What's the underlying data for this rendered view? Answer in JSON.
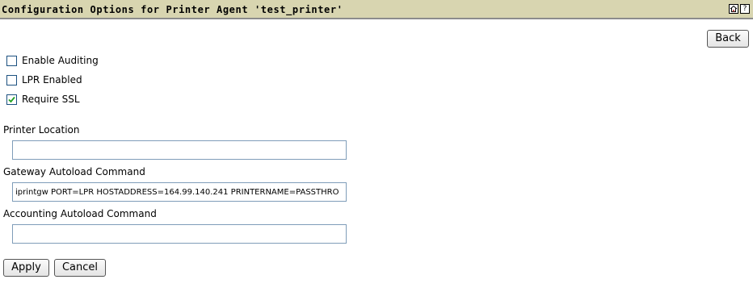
{
  "header": {
    "title": "Configuration Options for Printer Agent 'test_printer'",
    "icons": [
      "home-icon",
      "help-icon"
    ],
    "help_glyph": "?",
    "background_color": "#d8d5b0"
  },
  "back_label": "Back",
  "checkboxes": [
    {
      "label": "Enable Auditing",
      "checked": false
    },
    {
      "label": "LPR Enabled",
      "checked": false
    },
    {
      "label": "Require SSL",
      "checked": true
    }
  ],
  "fields": {
    "printer_location": {
      "label": "Printer Location",
      "value": ""
    },
    "gateway_autoload": {
      "label": "Gateway Autoload Command",
      "value": "iprintgw PORT=LPR HOSTADDRESS=164.99.140.241 PRINTERNAME=PASSTHRO"
    },
    "accounting_autoload": {
      "label": "Accounting Autoload Command",
      "value": ""
    }
  },
  "actions": {
    "apply_label": "Apply",
    "cancel_label": "Cancel"
  }
}
